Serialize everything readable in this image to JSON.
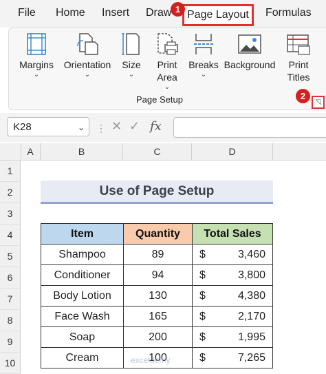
{
  "menu": {
    "items": [
      "File",
      "Home",
      "Insert",
      "Draw",
      "Page Layout",
      "Formulas"
    ],
    "active": "Page Layout"
  },
  "markers": {
    "first": "1",
    "second": "2"
  },
  "ribbon": {
    "buttons": [
      {
        "label": "Margins",
        "chevron": "⌄"
      },
      {
        "label": "Orientation",
        "chevron": "⌄"
      },
      {
        "label": "Size",
        "chevron": "⌄"
      },
      {
        "label": "Print",
        "label2": "Area",
        "chevron": "⌄"
      },
      {
        "label": "Breaks",
        "chevron": "⌄"
      },
      {
        "label": "Background"
      },
      {
        "label": "Print",
        "label2": "Titles"
      }
    ],
    "group_label": "Page Setup"
  },
  "formula_bar": {
    "name_box": "K28",
    "fx": "fx",
    "value": ""
  },
  "columns": [
    "A",
    "B",
    "C",
    "D"
  ],
  "rows": [
    "1",
    "2",
    "3",
    "4",
    "5",
    "6",
    "7",
    "8",
    "9",
    "10"
  ],
  "sheet": {
    "title": "Use of Page Setup",
    "headers": [
      "Item",
      "Quantity",
      "Total Sales"
    ],
    "rows": [
      {
        "item": "Shampoo",
        "qty": "89",
        "cur": "$",
        "amt": "3,460"
      },
      {
        "item": "Conditioner",
        "qty": "94",
        "cur": "$",
        "amt": "3,800"
      },
      {
        "item": "Body Lotion",
        "qty": "130",
        "cur": "$",
        "amt": "4,380"
      },
      {
        "item": "Face Wash",
        "qty": "165",
        "cur": "$",
        "amt": "2,170"
      },
      {
        "item": "Soap",
        "qty": "200",
        "cur": "$",
        "amt": "1,995"
      },
      {
        "item": "Cream",
        "qty": "100",
        "cur": "$",
        "amt": "7,265"
      }
    ]
  },
  "watermark": "exceldemy",
  "colors": {
    "accent_red": "#e03030",
    "header_item": "#bdd7ee",
    "header_qty": "#f8cbad",
    "header_sales": "#c6e0b4",
    "title_bg": "#e7ebf4"
  }
}
